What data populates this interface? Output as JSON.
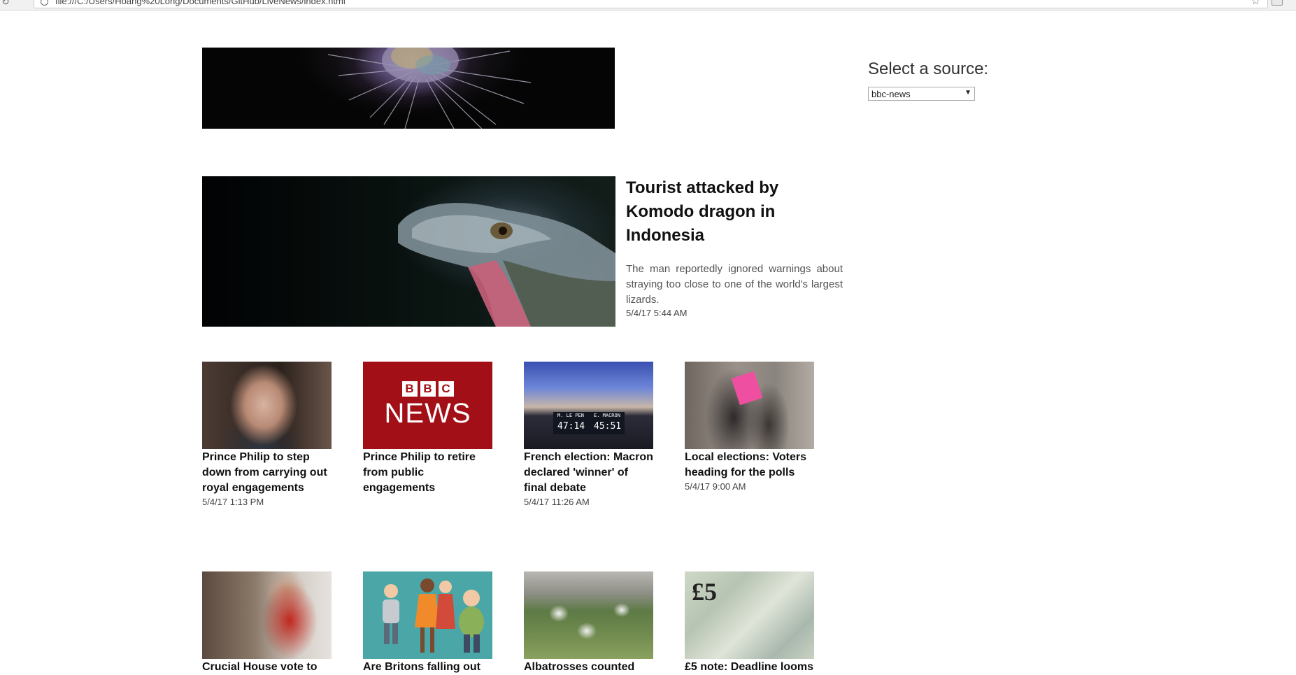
{
  "browser": {
    "url": "file:///C:/Users/Hoang%20Long/Documents/GitHub/LiveNews/index.html"
  },
  "sidebar": {
    "source_label": "Select a source:",
    "source_selected": "bbc-news"
  },
  "featured": {
    "title": "Tourist attacked by Komodo dragon in Indonesia",
    "description": "The man reportedly ignored warnings about straying too close to one of the world's largest lizards.",
    "time": "5/4/17 5:44 AM"
  },
  "articles": [
    {
      "title": "Prince Philip to step down from carrying out royal engagements",
      "time": "5/4/17 1:13 PM"
    },
    {
      "title": "Prince Philip to retire from public engagements",
      "time": ""
    },
    {
      "title": "French election: Macron declared 'winner' of final debate",
      "time": "5/4/17 11:26 AM"
    },
    {
      "title": "Local elections: Voters heading for the polls",
      "time": "5/4/17 9:00 AM"
    },
    {
      "title": "Crucial House vote to",
      "time": ""
    },
    {
      "title": "Are Britons falling out",
      "time": ""
    },
    {
      "title": "Albatrosses counted",
      "time": ""
    },
    {
      "title": "£5 note: Deadline looms",
      "time": ""
    }
  ],
  "thumb_text": {
    "bbc_letters": [
      "B",
      "B",
      "C"
    ],
    "bbc_news": "NEWS",
    "debate_name_1": "M. LE PEN",
    "debate_name_2": "E. MACRON",
    "debate_time_1": "47:14",
    "debate_time_2": "45:51",
    "note_value": "£5"
  },
  "icons": {
    "reload": "reload-icon",
    "info": "info-icon",
    "bookmark": "star-icon",
    "extension": "extension-icon",
    "dropdown": "chevron-down-icon"
  }
}
